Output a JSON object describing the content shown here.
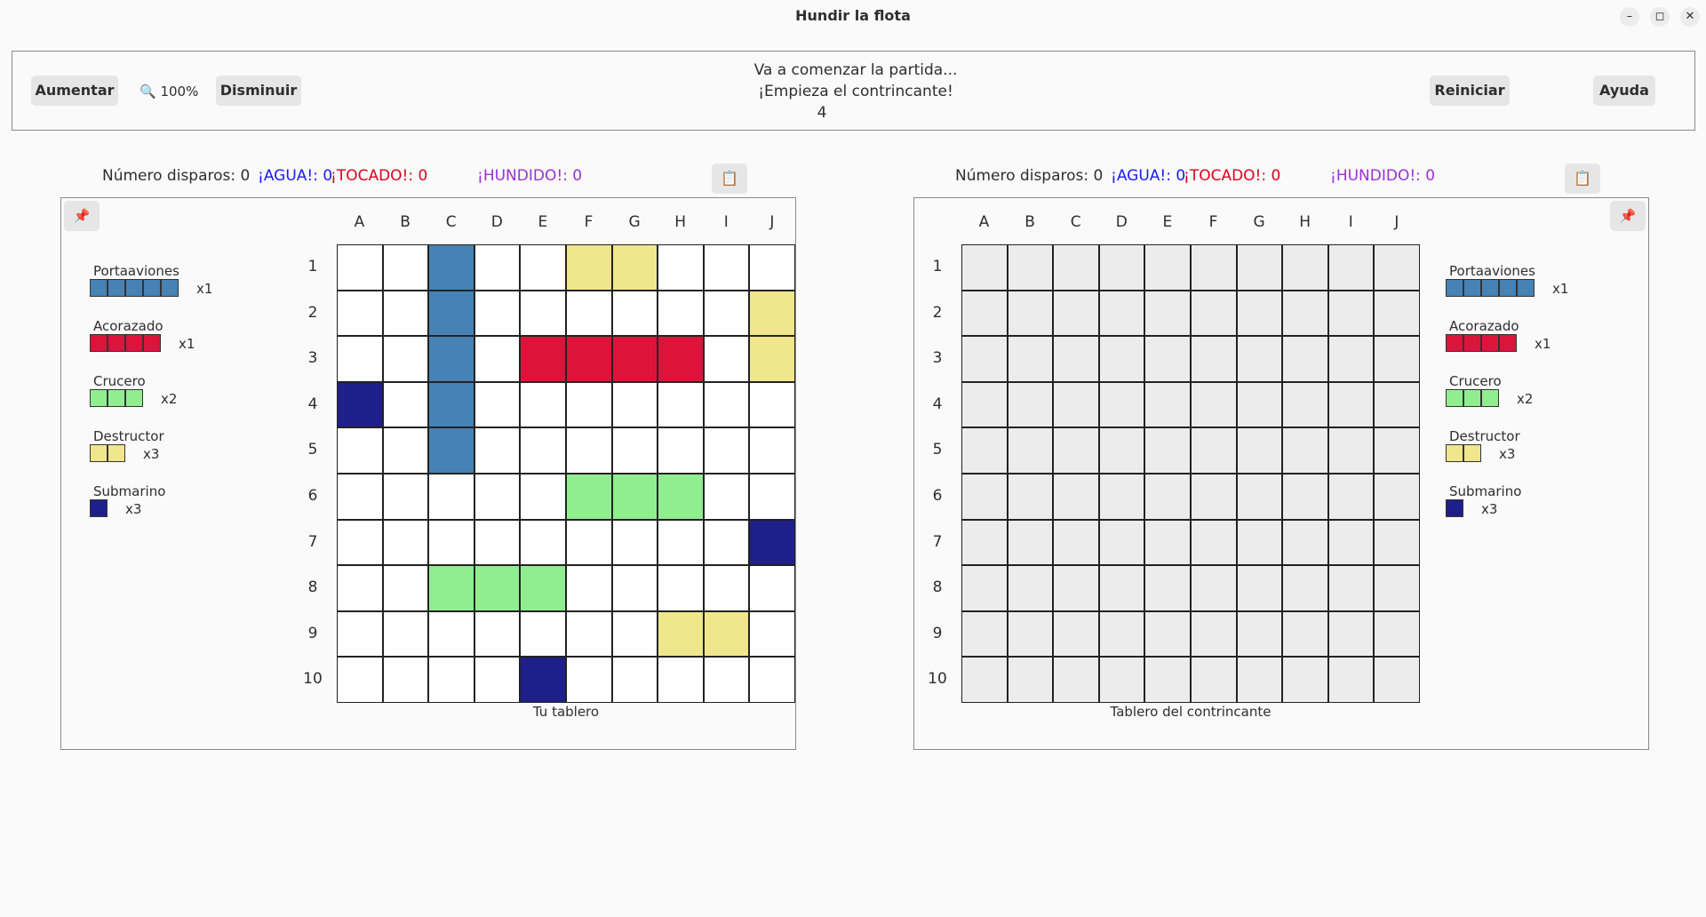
{
  "window": {
    "title": "Hundir la flota",
    "minimize": "–",
    "maximize": "◻",
    "close": "✕"
  },
  "toolbar": {
    "increase_label": "Aumentar",
    "zoom_icon": "magnifier-icon",
    "zoom_level": "100%",
    "decrease_label": "Disminuir",
    "restart_label": "Reiniciar",
    "help_label": "Ayuda"
  },
  "status": {
    "line1": "Va a comenzar la partida...",
    "line2": "¡Empieza el contrincante!",
    "line3": "4"
  },
  "colors": {
    "water": "#ffffff",
    "hidden": "#ececec",
    "P": "#4682b4",
    "A": "#dc143c",
    "C": "#90ee90",
    "D": "#f0e68c",
    "S": "#1f1f8a",
    "agua": "#1a1aff",
    "tocado": "#e0001b",
    "hundido": "#9b30d9"
  },
  "columns": [
    "A",
    "B",
    "C",
    "D",
    "E",
    "F",
    "G",
    "H",
    "I",
    "J"
  ],
  "rows": [
    "1",
    "2",
    "3",
    "4",
    "5",
    "6",
    "7",
    "8",
    "9",
    "10"
  ],
  "fleet": [
    {
      "name": "Portaaviones",
      "code": "P",
      "size": 5,
      "count": "x1"
    },
    {
      "name": "Acorazado",
      "code": "A",
      "size": 4,
      "count": "x1"
    },
    {
      "name": "Crucero",
      "code": "C",
      "size": 3,
      "count": "x2"
    },
    {
      "name": "Destructor",
      "code": "D",
      "size": 2,
      "count": "x3"
    },
    {
      "name": "Submarino",
      "code": "S",
      "size": 1,
      "count": "x3"
    }
  ],
  "player": {
    "shots_label": "Número disparos: 0",
    "agua_label": "¡AGUA!: 0",
    "tocado_label": "¡TOCADO!: 0",
    "hundido_label": "¡HUNDIDO!: 0",
    "copy_icon": "clipboard-icon",
    "pin_icon": "pin-icon",
    "caption": "Tu tablero",
    "board": [
      "..P..DD...",
      "..P......D",
      "..P.AAAA.D",
      "S.P.......",
      "..P.......",
      ".....CCC..",
      ".........S",
      "..CCC.....",
      ".......DD.",
      "....S....."
    ]
  },
  "opponent": {
    "shots_label": "Número disparos: 0",
    "agua_label": "¡AGUA!: 0",
    "tocado_label": "¡TOCADO!: 0",
    "hundido_label": "¡HUNDIDO!: 0",
    "copy_icon": "clipboard-icon",
    "pin_icon": "pin-icon",
    "caption": "Tablero del contrincante",
    "board": [
      "??????????",
      "??????????",
      "??????????",
      "??????????",
      "??????????",
      "??????????",
      "??????????",
      "??????????",
      "??????????",
      "??????????"
    ]
  }
}
